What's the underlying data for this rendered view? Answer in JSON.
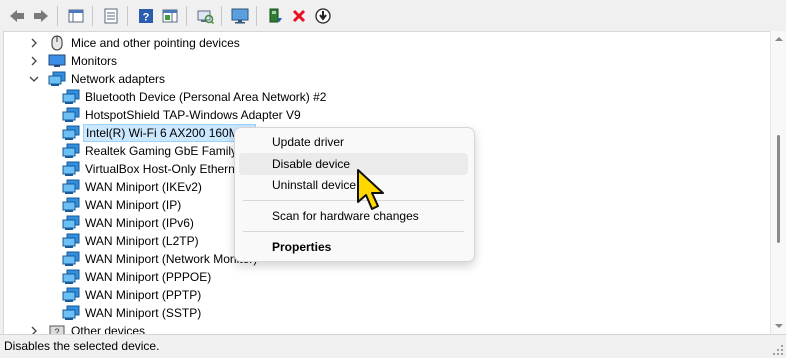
{
  "toolbar": {
    "buttons": [
      "back-icon",
      "forward-icon",
      "show-hide-console-tree-icon",
      "properties-icon",
      "help-icon",
      "action-pane-icon",
      "scan-hardware-changes-icon",
      "monitor-icon",
      "update-driver-icon",
      "uninstall-icon",
      "disable-device-icon"
    ]
  },
  "tree": {
    "nodes": [
      {
        "label": "Mice and other pointing devices",
        "expander": "collapsed",
        "icon": "mouse-icon"
      },
      {
        "label": "Monitors",
        "expander": "collapsed",
        "icon": "monitor-icon"
      },
      {
        "label": "Network adapters",
        "expander": "expanded",
        "icon": "network-adapter-icon"
      },
      {
        "label": "Bluetooth Device (Personal Area Network) #2",
        "icon": "network-adapter-icon"
      },
      {
        "label": "HotspotShield TAP-Windows Adapter V9",
        "icon": "network-adapter-icon"
      },
      {
        "label": "Intel(R) Wi-Fi 6 AX200 160MHz",
        "icon": "network-adapter-icon",
        "selected": true
      },
      {
        "label": "Realtek Gaming GbE Family Controller",
        "icon": "network-adapter-icon"
      },
      {
        "label": "VirtualBox Host-Only Ethernet Adapter",
        "icon": "network-adapter-icon"
      },
      {
        "label": "WAN Miniport (IKEv2)",
        "icon": "network-adapter-icon"
      },
      {
        "label": "WAN Miniport (IP)",
        "icon": "network-adapter-icon"
      },
      {
        "label": "WAN Miniport (IPv6)",
        "icon": "network-adapter-icon"
      },
      {
        "label": "WAN Miniport (L2TP)",
        "icon": "network-adapter-icon"
      },
      {
        "label": "WAN Miniport (Network Monitor)",
        "icon": "network-adapter-icon"
      },
      {
        "label": "WAN Miniport (PPPOE)",
        "icon": "network-adapter-icon"
      },
      {
        "label": "WAN Miniport (PPTP)",
        "icon": "network-adapter-icon"
      },
      {
        "label": "WAN Miniport (SSTP)",
        "icon": "network-adapter-icon"
      },
      {
        "label": "Other devices",
        "expander": "collapsed",
        "icon": "other-devices-icon"
      }
    ]
  },
  "context_menu": {
    "items": [
      "Update driver",
      "Disable device",
      "Uninstall device",
      "Scan for hardware changes",
      "Properties"
    ],
    "highlighted": "Disable device"
  },
  "status_bar": {
    "text": "Disables the selected device."
  },
  "colors": {
    "accent": "#0078d4",
    "selection": "#cce8ff",
    "selection_border": "#99d1ff",
    "cursor_yellow": "#ffd800",
    "uninstall_red": "#e81123"
  }
}
